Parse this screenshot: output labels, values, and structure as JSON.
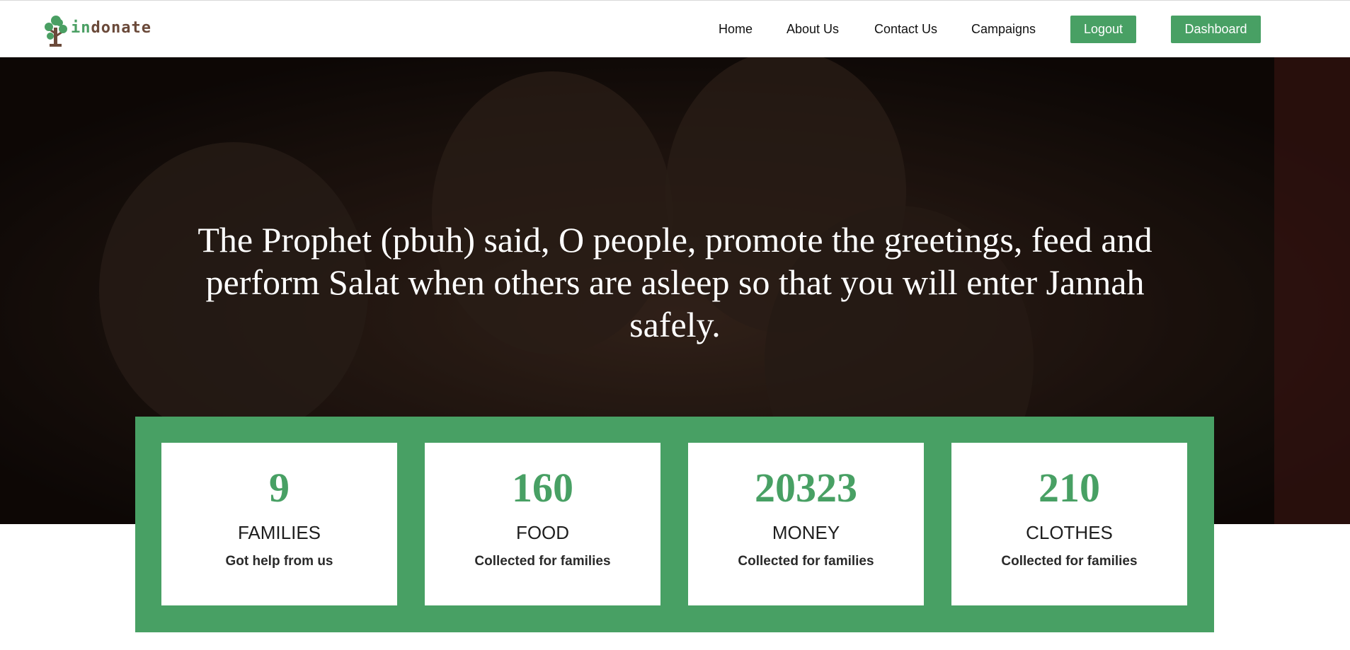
{
  "brand": {
    "logo_text_part1": "in",
    "logo_text_part2": "donate",
    "icon": "tree-logo-icon",
    "colors": {
      "green": "#4a9f63",
      "brown": "#6b4a3a"
    }
  },
  "nav": {
    "links": [
      {
        "label": "Home"
      },
      {
        "label": "About Us"
      },
      {
        "label": "Contact Us"
      },
      {
        "label": "Campaigns"
      }
    ],
    "logout_label": "Logout",
    "dashboard_label": "Dashboard"
  },
  "hero": {
    "quote": "The Prophet (pbuh) said, O people, promote the greetings, feed and perform Salat when others are asleep so that you will enter Jannah safely."
  },
  "stats": [
    {
      "value": "9",
      "title": "FAMILIES",
      "subtitle": "Got help from us"
    },
    {
      "value": "160",
      "title": "FOOD",
      "subtitle": "Collected for families"
    },
    {
      "value": "20323",
      "title": "MONEY",
      "subtitle": "Collected for families"
    },
    {
      "value": "210",
      "title": "CLOTHES",
      "subtitle": "Collected for families"
    }
  ],
  "theme": {
    "accent": "#48a064",
    "hero_overlay": "#1c120d"
  }
}
